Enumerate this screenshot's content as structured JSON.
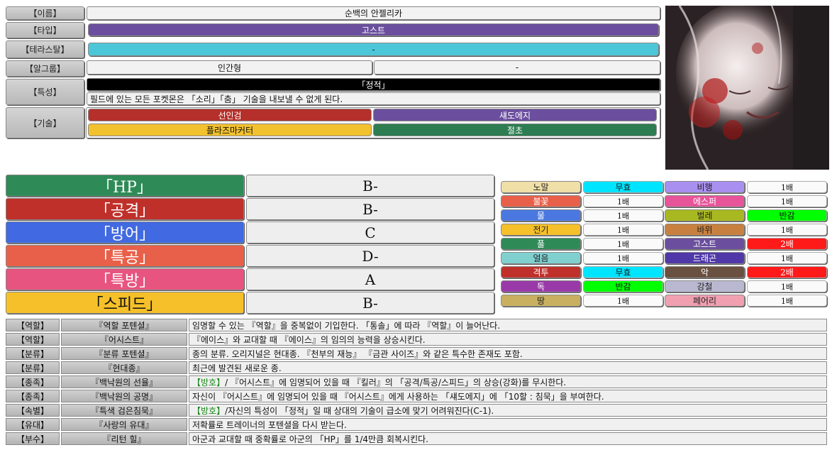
{
  "info": {
    "name_label": "【이름】",
    "name_value": "순백의 안젤리카",
    "type_label": "【타입】",
    "type_value": "고스트",
    "tera_label": "【테라스탈】",
    "tera_value": "-",
    "egg_label": "【알그룹】",
    "egg_value_1": "인간형",
    "egg_value_2": "-",
    "ability_label": "【특성】",
    "ability_name": "「정적」",
    "ability_desc": "필드에 있는 모든 포켓몬은 「소리」「춤」 기술을 내보낼 수 없게 된다.",
    "moves_label": "【기술】",
    "moves": [
      "선인검",
      "섀도에지",
      "플라즈마커터",
      "절초"
    ]
  },
  "colors": {
    "ghost": "#6b4f9e",
    "tera": "#4cc7d9",
    "black": "#000000",
    "move1": "#b5302a",
    "move2": "#6b4f9e",
    "move3": "#f2c12e",
    "move4": "#2e7d52"
  },
  "stats": [
    {
      "name": "「HP」",
      "grade": "B-",
      "color": "#2e8b57"
    },
    {
      "name": "「공격」",
      "grade": "B-",
      "color": "#c0302a"
    },
    {
      "name": "「방어」",
      "grade": "C",
      "color": "#4169e1"
    },
    {
      "name": "「특공」",
      "grade": "D-",
      "color": "#e8604a"
    },
    {
      "name": "「특방」",
      "grade": "A",
      "color": "#e75480"
    },
    {
      "name": "「스피드」",
      "grade": "B-",
      "color": "#f5c02a"
    }
  ],
  "matchups": [
    {
      "type": "노말",
      "mult": "무효",
      "color": "#f0e0a8",
      "mult_color": "#00e5ff"
    },
    {
      "type": "불꽃",
      "mult": "1배",
      "color": "#e8604a",
      "mult_color": ""
    },
    {
      "type": "물",
      "mult": "1배",
      "color": "#4a78e0",
      "mult_color": ""
    },
    {
      "type": "전기",
      "mult": "1배",
      "color": "#f5c02a",
      "mult_color": ""
    },
    {
      "type": "풀",
      "mult": "1배",
      "color": "#2e8b57",
      "mult_color": ""
    },
    {
      "type": "얼음",
      "mult": "1배",
      "color": "#80d0d0",
      "mult_color": ""
    },
    {
      "type": "격투",
      "mult": "무효",
      "color": "#c0302a",
      "mult_color": "#00e5ff"
    },
    {
      "type": "독",
      "mult": "반감",
      "color": "#9a3aa8",
      "mult_color": "#00ff00"
    },
    {
      "type": "땅",
      "mult": "1배",
      "color": "#c8b060",
      "mult_color": ""
    },
    {
      "type": "비행",
      "mult": "1배",
      "color": "#a890f0",
      "mult_color": ""
    },
    {
      "type": "에스퍼",
      "mult": "1배",
      "color": "#e7549a",
      "mult_color": ""
    },
    {
      "type": "벌레",
      "mult": "반감",
      "color": "#a8b820",
      "mult_color": "#00ff00"
    },
    {
      "type": "바위",
      "mult": "1배",
      "color": "#c88040",
      "mult_color": ""
    },
    {
      "type": "고스트",
      "mult": "2배",
      "color": "#6b4f9e",
      "mult_color": "#ff1a1a"
    },
    {
      "type": "드래곤",
      "mult": "1배",
      "color": "#5038a8",
      "mult_color": ""
    },
    {
      "type": "악",
      "mult": "2배",
      "color": "#6a5040",
      "mult_color": "#ff1a1a"
    },
    {
      "type": "강철",
      "mult": "1배",
      "color": "#b8b8d0",
      "mult_color": ""
    },
    {
      "type": "페어리",
      "mult": "1배",
      "color": "#f0a0b0",
      "mult_color": ""
    }
  ],
  "notes": [
    {
      "tag": "【역할】",
      "name": "『역할 포텐셜』",
      "desc_pre": "",
      "desc_green": "",
      "desc": "임명할 수 있는 『역할』을 중복없이 기입한다. 「통솔」에 따라 『역할』이 늘어난다."
    },
    {
      "tag": "【역할】",
      "name": "『어시스트』",
      "desc_pre": "",
      "desc_green": "",
      "desc": "『에이스』와 교대할 때 『에이스』의 임의의 능력을 상승시킨다."
    },
    {
      "tag": "【분류】",
      "name": "『분류 포텐셜』",
      "desc_pre": "",
      "desc_green": "",
      "desc": "종의 분류. 오리지널은 현대종. 『천부의 재능』 『금관 사이즈』와 같은 특수한 존재도 포함."
    },
    {
      "tag": "【분류】",
      "name": "『현대종』",
      "desc_pre": "",
      "desc_green": "",
      "desc": "최근에 발견된 새로운 종."
    },
    {
      "tag": "【종족】",
      "name": "『백낙원의 선율』",
      "desc_pre": "",
      "desc_green": "【방호】",
      "desc": " / 『어시스트』에 임명되어 있을 때 『킬러』의 「공격/특공/스피드」의 상승(강화)를 무시한다."
    },
    {
      "tag": "【종족】",
      "name": "『백낙원의 공명』",
      "desc_pre": "",
      "desc_green": "",
      "desc": "자신이 『어시스트』에 임명되어 있을 때 『어시스트』에게 사용하는 「섀도에지」에 「10할 : 침묵」을 부여한다."
    },
    {
      "tag": "【속별】",
      "name": "『특색 검은침묵』",
      "desc_pre": "",
      "desc_green": "【방호】",
      "desc": "/자신의 특성이 「정적」일 때 상대의 기술이 급소에 맞기 어려워진다(C-1)."
    },
    {
      "tag": "【유대】",
      "name": "『사랑의 유대』",
      "desc_pre": "",
      "desc_green": "",
      "desc": "저확률로 트레이너의 포텐셜을 다시 받는다."
    },
    {
      "tag": "【부수】",
      "name": "『리턴 힐』",
      "desc_pre": "",
      "desc_green": "",
      "desc": "아군과 교대할 때 중확률로 아군의 「HP」를 1/4만큼 회복시킨다."
    }
  ]
}
